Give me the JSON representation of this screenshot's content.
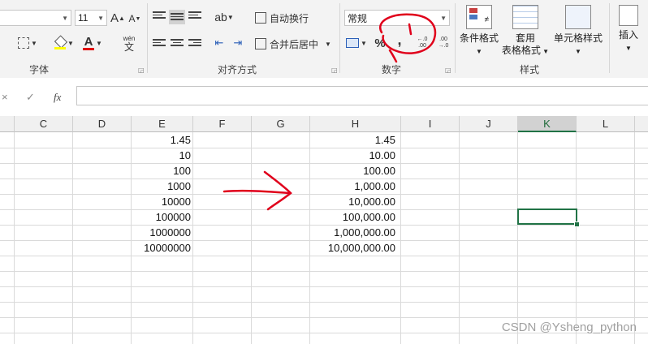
{
  "ribbon": {
    "font_size": "11",
    "font_grow": "A",
    "font_shrink": "A",
    "phonetic_glyph": "文",
    "phonetic_top": "wén",
    "font_color_glyph": "A",
    "groups": {
      "font": "字体",
      "alignment": "对齐方式",
      "number": "数字",
      "styles": "样式"
    },
    "wrap_text_label": "自动换行",
    "merge_center_label": "合并后居中",
    "number_format_value": "常规",
    "percent_glyph": "%",
    "comma_glyph": ",",
    "increase_decimal_glyph": "←.0 .00",
    "decrease_decimal_glyph": ".00 →.0",
    "conditional_format_label": "条件格式",
    "table_format_label_1": "套用",
    "table_format_label_2": "表格格式",
    "cell_styles_label": "单元格样式",
    "insert_label": "插入"
  },
  "formula_bar": {
    "cancel_glyph": "×",
    "enter_glyph": "✓",
    "fx_glyph": "fx",
    "value": ""
  },
  "grid": {
    "columns": [
      "C",
      "D",
      "E",
      "F",
      "G",
      "H",
      "I",
      "J",
      "K",
      "L"
    ],
    "selected_column": "K",
    "col_e_values": [
      "1.45",
      "10",
      "100",
      "1000",
      "10000",
      "100000",
      "1000000",
      "10000000"
    ],
    "col_h_values": [
      "1.45",
      "10.00",
      "100.00",
      "1,000.00",
      "10,000.00",
      "100,000.00",
      "1,000,000.00",
      "10,000,000.00"
    ]
  },
  "annotation_color": "#e0001b",
  "accent_color": "#217346",
  "watermark": "CSDN @Ysheng_python"
}
